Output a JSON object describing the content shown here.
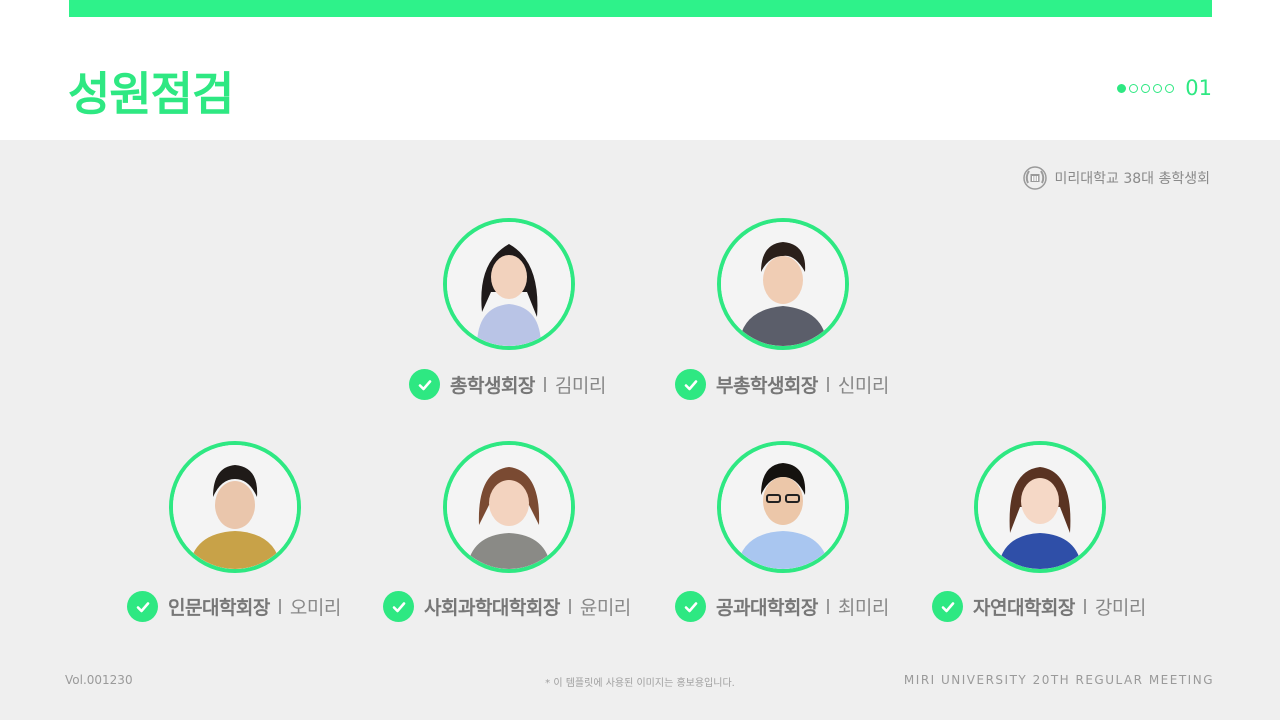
{
  "header": {
    "title": "성원점검",
    "page_number": "01",
    "pager_total": 5,
    "pager_active": 1
  },
  "org_label": "미리대학교 38대 총학생회",
  "members": [
    {
      "role": "총학생회장",
      "name": "김미리"
    },
    {
      "role": "부총학생회장",
      "name": "신미리"
    },
    {
      "role": "인문대학회장",
      "name": "오미리"
    },
    {
      "role": "사회과학대학회장",
      "name": "윤미리"
    },
    {
      "role": "공과대학회장",
      "name": "최미리"
    },
    {
      "role": "자연대학회장",
      "name": "강미리"
    }
  ],
  "footer": {
    "volume": "Vol.001230",
    "notice": "* 이 템플릿에 사용된 이미지는 홍보용입니다.",
    "meeting": "MIRI UNIVERSITY 20TH REGULAR MEETING"
  },
  "colors": {
    "accent": "#2ee882",
    "band": "#2ef28a",
    "background": "#efefef"
  },
  "icons": [
    "check-icon",
    "university-emblem-icon",
    "person-photo"
  ]
}
